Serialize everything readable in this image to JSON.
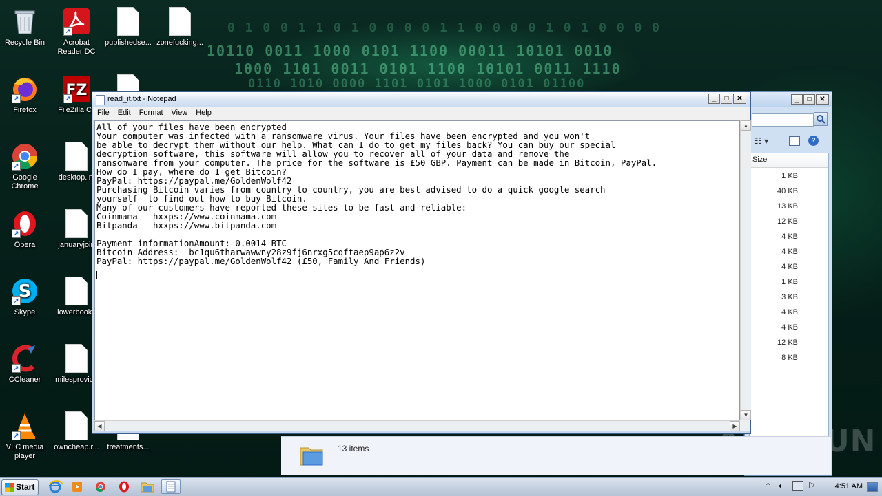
{
  "desktop": {
    "icons": [
      {
        "label": "Recycle Bin"
      },
      {
        "label": "Acrobat Reader DC"
      },
      {
        "label": "publishedse..."
      },
      {
        "label": "zonefucking..."
      },
      {
        "label": "Firefox"
      },
      {
        "label": "FileZilla Cli"
      },
      {
        "label": "Google Chrome"
      },
      {
        "label": "desktop.ini"
      },
      {
        "label": "Opera"
      },
      {
        "label": "januaryjoin"
      },
      {
        "label": "Skype"
      },
      {
        "label": "lowerbooks"
      },
      {
        "label": "CCleaner"
      },
      {
        "label": "milesprovide"
      },
      {
        "label": "VLC media player"
      },
      {
        "label": "owncheap.r..."
      },
      {
        "label": "treatments..."
      }
    ],
    "watermark": "ANY RUN"
  },
  "notepad": {
    "title": "read_it.txt - Notepad",
    "menu": [
      "File",
      "Edit",
      "Format",
      "View",
      "Help"
    ],
    "content": "All of your files have been encrypted\nYour computer was infected with a ransomware virus. Your files have been encrypted and you won't\nbe able to decrypt them without our help. What can I do to get my files back? You can buy our special\ndecryption software, this software will allow you to recover all of your data and remove the\nransomware from your computer. The price for the software is £50 GBP. Payment can be made in Bitcoin, PayPal.\nHow do I pay, where do I get Bitcoin?\nPayPal: https://paypal.me/GoldenWolf42\nPurchasing Bitcoin varies from country to country, you are best advised to do a quick google search\nyourself  to find out how to buy Bitcoin.\nMany of our customers have reported these sites to be fast and reliable:\nCoinmama - hxxps://www.coinmama.com\nBitpanda - hxxps://www.bitpanda.com\n\nPayment informationAmount: 0.0014 BTC\nBitcoin Address:  bc1qu6tharwawwny28z9fj6nrxg5cqftaep9ap6z2v\nPayPal: https://paypal.me/GoldenWolf42 (£50, Family And Friends)\n"
  },
  "explorer": {
    "column_header": "Size",
    "sizes": [
      "1 KB",
      "40 KB",
      "13 KB",
      "12 KB",
      "4 KB",
      "4 KB",
      "4 KB",
      "1 KB",
      "3 KB",
      "4 KB",
      "4 KB",
      "12 KB",
      "8 KB"
    ],
    "status": "13 items"
  },
  "taskbar": {
    "start_label": "Start",
    "clock": "4:51 AM"
  }
}
